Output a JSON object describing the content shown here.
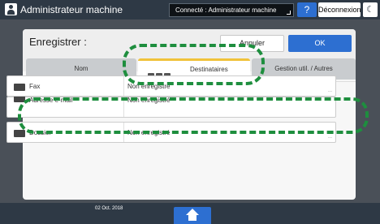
{
  "topbar": {
    "title": "Administrateur machine",
    "connection_status": "Connecté : Administrateur machine",
    "help_label": "?",
    "logout_label": "Déconnexion",
    "sleep_icon": "moon-icon"
  },
  "header": {
    "title": "Enregistrer :",
    "cancel_label": "Annuler",
    "ok_label": "OK"
  },
  "tabs": [
    {
      "label": "Nom",
      "selected": false
    },
    {
      "label": "Destinataires",
      "selected": true
    },
    {
      "label": "Gestion util. / Autres",
      "selected": false
    }
  ],
  "rows": [
    {
      "label": "Fax",
      "value": "Non enregistré",
      "icon": "fax-icon"
    },
    {
      "label": "Adresse e-mail",
      "value": "Non enregistré",
      "icon": "email-icon"
    },
    {
      "label": "Dossier",
      "value": "Non enregistré",
      "icon": "folder-icon"
    }
  ],
  "bottom": {
    "date": "02 Oct. 2018",
    "home_icon": "home-icon"
  },
  "colors": {
    "accent": "#2d6fd1",
    "highlight": "#1e8e3e",
    "tab_indicator": "#f0c23a",
    "dark_bar": "#2e3945"
  }
}
